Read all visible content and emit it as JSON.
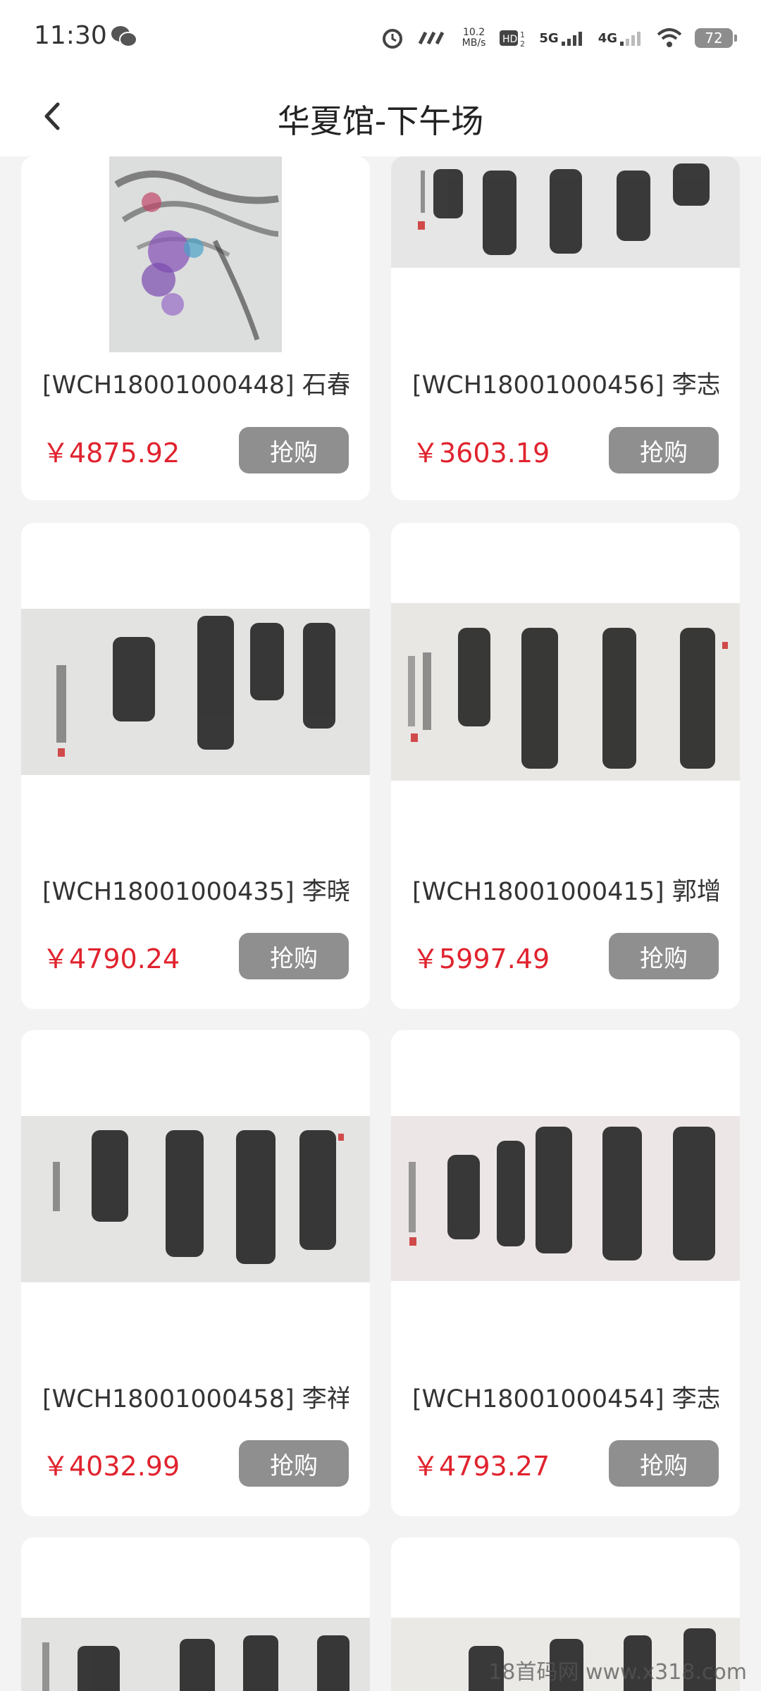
{
  "status_bar": {
    "time": "11:30",
    "speed_value": "10.2",
    "speed_unit": "MB/s",
    "net1": "5G",
    "net2": "4G",
    "battery": "72"
  },
  "header": {
    "title": "华夏馆-下午场"
  },
  "items": [
    {
      "title": "[WCH18001000448] 石春...",
      "price": "￥4875.92",
      "buy": "抢购"
    },
    {
      "title": "[WCH18001000456] 李志...",
      "price": "￥3603.19",
      "buy": "抢购"
    },
    {
      "title": "[WCH18001000435] 李晓...",
      "price": "￥4790.24",
      "buy": "抢购"
    },
    {
      "title": "[WCH18001000415] 郭增...",
      "price": "￥5997.49",
      "buy": "抢购"
    },
    {
      "title": "[WCH18001000458] 李祥...",
      "price": "￥4032.99",
      "buy": "抢购"
    },
    {
      "title": "[WCH18001000454] 李志...",
      "price": "￥4793.27",
      "buy": "抢购"
    }
  ],
  "watermark": "18首码网 www.x318.com",
  "colors": {
    "price": "#e0232e",
    "button": "#8f8f8f",
    "background": "#f3f3f3"
  }
}
